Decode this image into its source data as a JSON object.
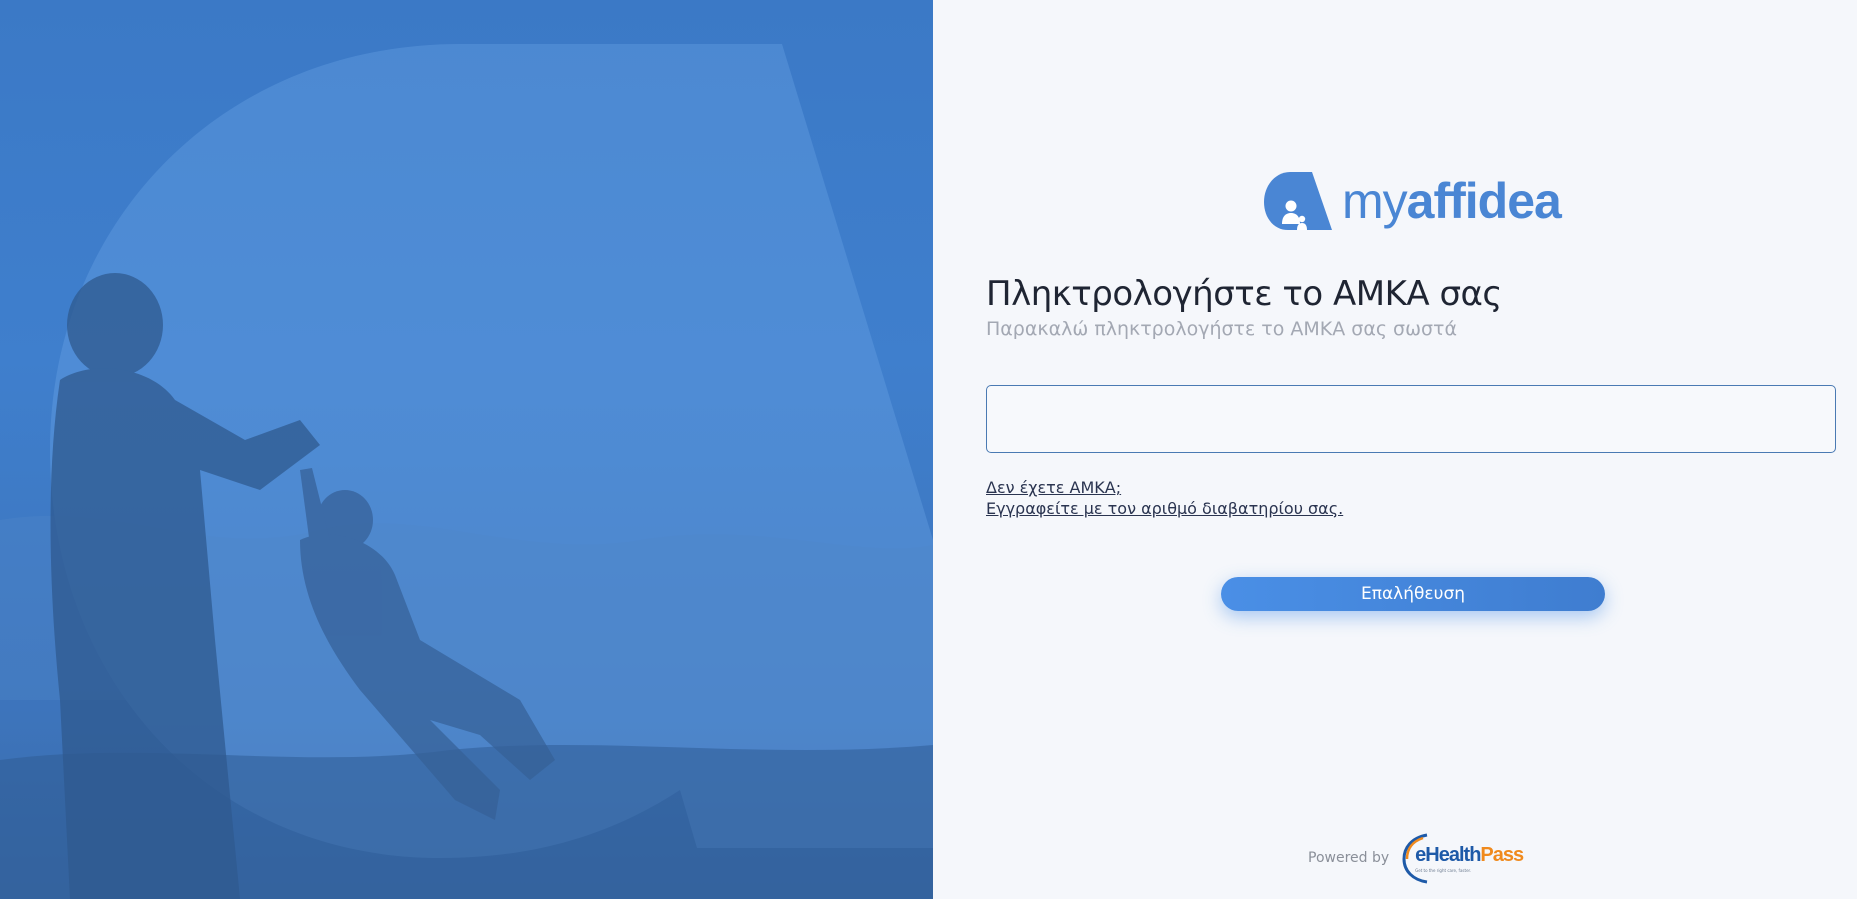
{
  "brand": {
    "logo_prefix": "my",
    "logo_suffix": "affidea",
    "accent_color": "#4a86d4"
  },
  "form": {
    "title": "Πληκτρολογήστε το ΑΜΚΑ σας",
    "subtitle": "Παρακαλώ πληκτρολογήστε το ΑΜΚΑ σας σωστά",
    "amka_value": "",
    "amka_placeholder": ""
  },
  "links": {
    "no_amka": "Δεν έχετε ΑΜΚΑ;",
    "register_passport": "Εγγραφείτε με τον αριθμό διαβατηρίου σας."
  },
  "actions": {
    "verify_label": "Επαλήθευση"
  },
  "footer": {
    "powered_by": "Powered by",
    "partner_e": "e",
    "partner_health": "Health",
    "partner_pass": "Pass",
    "partner_tag": "Get to the right care, faster."
  },
  "colors": {
    "left_panel": "#3f7fcd",
    "button": "#4a8fe6",
    "partner_orange": "#f08a1d",
    "partner_blue": "#1e5aa8"
  }
}
